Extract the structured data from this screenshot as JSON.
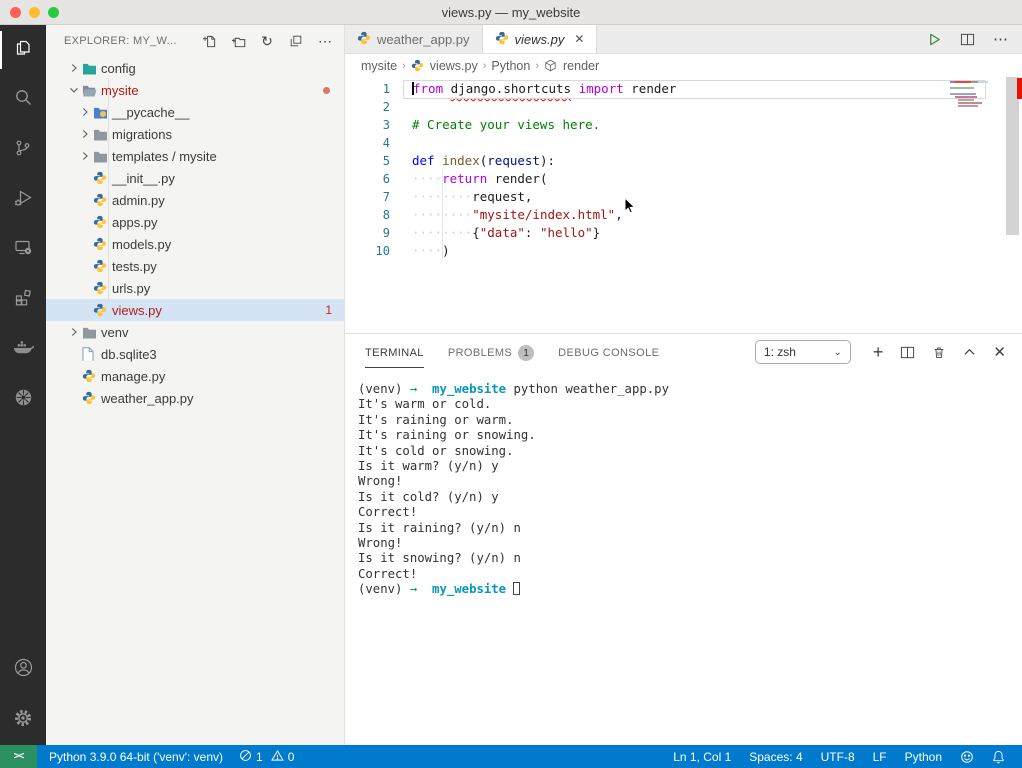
{
  "window": {
    "title": "views.py — my_website"
  },
  "icons": {
    "close": "✕",
    "plus": "+",
    "more": "⋯",
    "refresh": "↻",
    "chevron_down": "⌄"
  },
  "colors": {
    "status_bar": "#007ACC",
    "remote_green": "#2B9160",
    "error_red": "#B21A1A",
    "accent_blue": "#0598BC"
  },
  "activity_bar": {
    "items": [
      "explorer",
      "search",
      "source-control",
      "run-debug",
      "remote-explorer",
      "extensions",
      "docker",
      "kubernetes"
    ],
    "bottom_items": [
      "account",
      "settings"
    ],
    "active": "explorer"
  },
  "explorer": {
    "header": {
      "title": "EXPLORER: MY_W...",
      "actions": [
        "new-file",
        "new-folder",
        "refresh",
        "collapse-all",
        "more"
      ]
    },
    "tree": [
      {
        "label": "config",
        "level": 0,
        "arrow": "right",
        "icon": "folder-teal"
      },
      {
        "label": "mysite",
        "level": 0,
        "arrow": "down",
        "icon": "folder-open",
        "error": true,
        "badge": "dot"
      },
      {
        "label": "__pycache__",
        "level": 1,
        "arrow": "right",
        "icon": "folder-blue"
      },
      {
        "label": "migrations",
        "level": 1,
        "arrow": "right",
        "icon": "folder-gray"
      },
      {
        "label": "templates / mysite",
        "level": 1,
        "arrow": "right",
        "icon": "folder-gray"
      },
      {
        "label": "__init__.py",
        "level": 1,
        "icon": "python"
      },
      {
        "label": "admin.py",
        "level": 1,
        "icon": "python"
      },
      {
        "label": "apps.py",
        "level": 1,
        "icon": "python"
      },
      {
        "label": "models.py",
        "level": 1,
        "icon": "python"
      },
      {
        "label": "tests.py",
        "level": 1,
        "icon": "python"
      },
      {
        "label": "urls.py",
        "level": 1,
        "icon": "python"
      },
      {
        "label": "views.py",
        "level": 1,
        "icon": "python",
        "error": true,
        "selected": true,
        "badge": "1"
      },
      {
        "label": "venv",
        "level": 0,
        "arrow": "right",
        "icon": "folder-gray"
      },
      {
        "label": "db.sqlite3",
        "level": 0,
        "icon": "file"
      },
      {
        "label": "manage.py",
        "level": 0,
        "icon": "python"
      },
      {
        "label": "weather_app.py",
        "level": 0,
        "icon": "python"
      }
    ]
  },
  "editor": {
    "tabs": [
      {
        "label": "weather_app.py",
        "active": false
      },
      {
        "label": "views.py",
        "active": true
      }
    ],
    "actions": [
      "run-python-file",
      "split-editor",
      "more"
    ],
    "breadcrumb": [
      "mysite",
      "views.py",
      "Python",
      "render"
    ],
    "code": [
      {
        "num": "1",
        "caret": true,
        "current": true,
        "segs": [
          {
            "t": "from",
            "c": "k"
          },
          {
            "t": " ",
            "c": "p"
          },
          {
            "t": "django.shortcuts",
            "c": "p e"
          },
          {
            "t": " ",
            "c": "p"
          },
          {
            "t": "import",
            "c": "k"
          },
          {
            "t": " render",
            "c": "p"
          }
        ]
      },
      {
        "num": "2",
        "segs": []
      },
      {
        "num": "3",
        "segs": [
          {
            "t": "# Create your views here.",
            "c": "c"
          }
        ]
      },
      {
        "num": "4",
        "segs": []
      },
      {
        "num": "5",
        "segs": [
          {
            "t": "def",
            "c": "d"
          },
          {
            "t": " ",
            "c": "p"
          },
          {
            "t": "index",
            "c": "f"
          },
          {
            "t": "(",
            "c": "p"
          },
          {
            "t": "request",
            "c": "v"
          },
          {
            "t": "):",
            "c": "p"
          }
        ]
      },
      {
        "num": "6",
        "segs": [
          {
            "t": "····",
            "c": "w"
          },
          {
            "t": "return",
            "c": "k"
          },
          {
            "t": " render(",
            "c": "p"
          }
        ]
      },
      {
        "num": "7",
        "segs": [
          {
            "t": "········",
            "c": "w"
          },
          {
            "t": "request,",
            "c": "p"
          }
        ]
      },
      {
        "num": "8",
        "segs": [
          {
            "t": "········",
            "c": "w"
          },
          {
            "t": "\"mysite/index.html\"",
            "c": "s"
          },
          {
            "t": ",",
            "c": "p"
          }
        ]
      },
      {
        "num": "9",
        "segs": [
          {
            "t": "········",
            "c": "w"
          },
          {
            "t": "{",
            "c": "p"
          },
          {
            "t": "\"data\"",
            "c": "s"
          },
          {
            "t": ": ",
            "c": "p"
          },
          {
            "t": "\"hello\"",
            "c": "s"
          },
          {
            "t": "}",
            "c": "p"
          }
        ]
      },
      {
        "num": "10",
        "segs": [
          {
            "t": "····",
            "c": "w"
          },
          {
            "t": ")",
            "c": "p"
          }
        ]
      }
    ]
  },
  "panel": {
    "tabs": [
      {
        "label": "TERMINAL",
        "active": true
      },
      {
        "label": "PROBLEMS",
        "badge": "1"
      },
      {
        "label": "DEBUG CONSOLE"
      }
    ],
    "shell": "1: zsh",
    "actions": [
      "new-terminal",
      "split-terminal",
      "kill-terminal",
      "maximize-panel",
      "close-panel"
    ]
  },
  "terminal": {
    "lines": [
      {
        "segs": [
          {
            "t": "(venv) ",
            "c": "p"
          },
          {
            "t": "→",
            "c": "g"
          },
          {
            "t": "  ",
            "c": "p"
          },
          {
            "t": "my_website",
            "c": "b"
          },
          {
            "t": " python weather_app.py",
            "c": "p"
          }
        ]
      },
      {
        "segs": [
          {
            "t": "It's warm or cold.",
            "c": "p"
          }
        ]
      },
      {
        "segs": [
          {
            "t": "It's raining or warm.",
            "c": "p"
          }
        ]
      },
      {
        "segs": [
          {
            "t": "It's raining or snowing.",
            "c": "p"
          }
        ]
      },
      {
        "segs": [
          {
            "t": "It's cold or snowing.",
            "c": "p"
          }
        ]
      },
      {
        "segs": [
          {
            "t": "Is it warm? (y/n) y",
            "c": "p"
          }
        ]
      },
      {
        "segs": [
          {
            "t": "Wrong!",
            "c": "p"
          }
        ]
      },
      {
        "segs": [
          {
            "t": "Is it cold? (y/n) y",
            "c": "p"
          }
        ]
      },
      {
        "segs": [
          {
            "t": "Correct!",
            "c": "p"
          }
        ]
      },
      {
        "segs": [
          {
            "t": "Is it raining? (y/n) n",
            "c": "p"
          }
        ]
      },
      {
        "segs": [
          {
            "t": "Wrong!",
            "c": "p"
          }
        ]
      },
      {
        "segs": [
          {
            "t": "Is it snowing? (y/n) n",
            "c": "p"
          }
        ]
      },
      {
        "segs": [
          {
            "t": "Correct!",
            "c": "p"
          }
        ]
      },
      {
        "segs": [
          {
            "t": "(venv) ",
            "c": "p"
          },
          {
            "t": "→",
            "c": "g"
          },
          {
            "t": "  ",
            "c": "p"
          },
          {
            "t": "my_website ",
            "c": "b"
          },
          {
            "t": "",
            "c": "cursor"
          }
        ]
      }
    ]
  },
  "status_bar": {
    "left": {
      "remote": "><",
      "python": "Python 3.9.0 64-bit ('venv': venv)",
      "errors": "1",
      "warnings": "0"
    },
    "right": [
      "Ln 1, Col 1",
      "Spaces: 4",
      "UTF-8",
      "LF",
      "Python"
    ]
  }
}
